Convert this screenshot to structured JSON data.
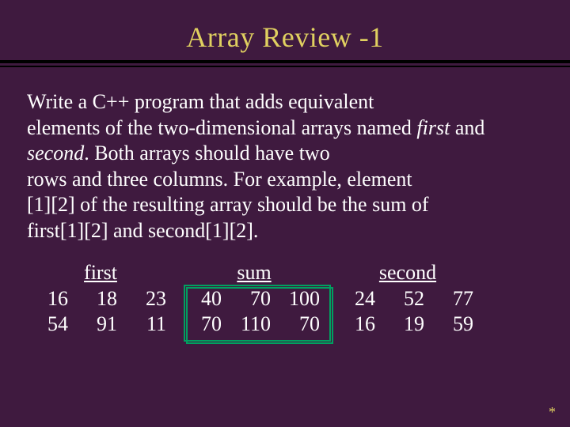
{
  "title": "Array Review -1",
  "body": {
    "line1": "Write a C++ program that adds equivalent",
    "line2a": "elements of the two-dimensional arrays named ",
    "line2b_first": "first",
    "line2c": " and ",
    "line2d_second": "second",
    "line2e": ". Both arrays should have two",
    "line3": "rows and three columns. For example, element",
    "line4": "[1][2] of the resulting array should be the sum of",
    "line5": "first[1][2] and second[1][2]."
  },
  "tables": {
    "first": {
      "label": "first",
      "r0c0": "16",
      "r0c1": "18",
      "r0c2": "23",
      "r1c0": "54",
      "r1c1": "91",
      "r1c2": "11"
    },
    "sum": {
      "label": "sum",
      "r0c0": "40",
      "r0c1": "70",
      "r0c2": "100",
      "r1c0": "70",
      "r1c1": "110",
      "r1c2": "70"
    },
    "second": {
      "label": "second",
      "r0c0": "24",
      "r0c1": "52",
      "r0c2": "77",
      "r1c0": "16",
      "r1c1": "19",
      "r1c2": "59"
    }
  },
  "footer": "*"
}
